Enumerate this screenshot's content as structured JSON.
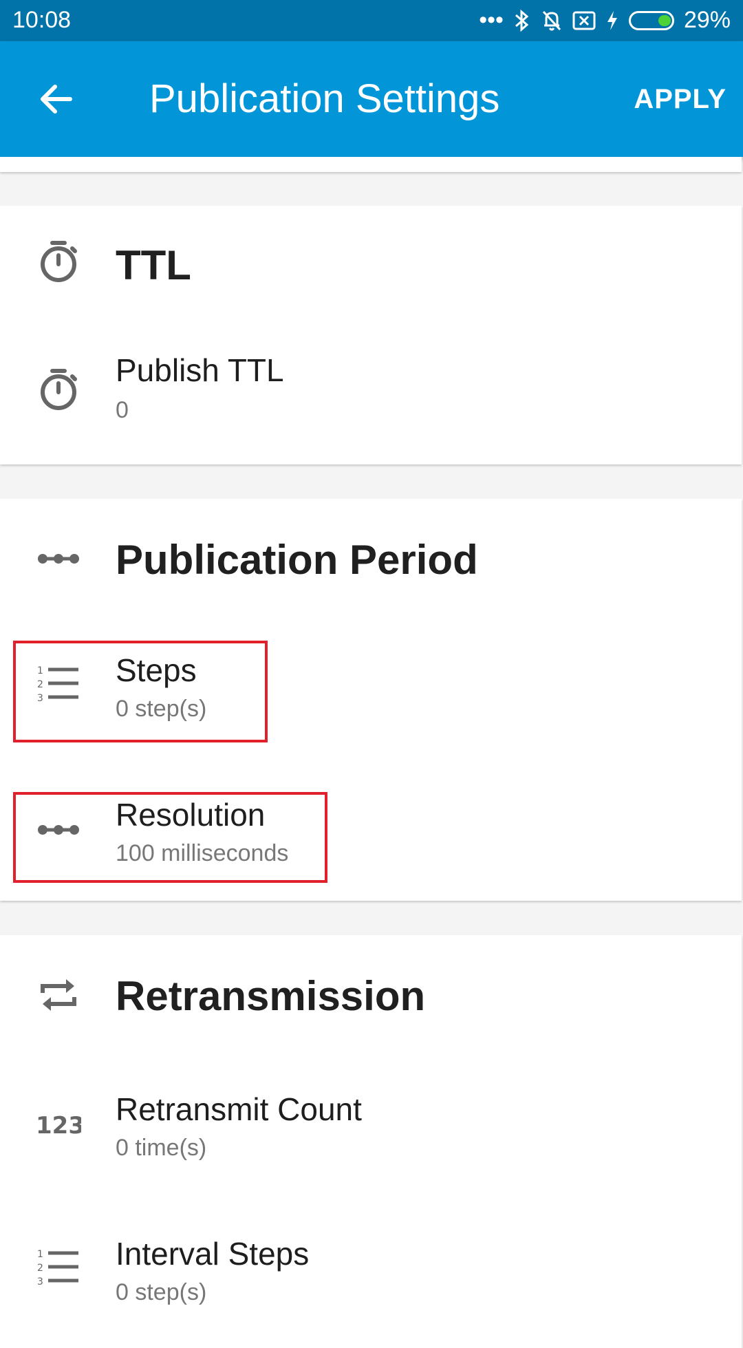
{
  "status_bar": {
    "time": "10:08",
    "battery": "29%",
    "icons": [
      "more-dots-icon",
      "bluetooth-icon",
      "notifications-off-icon",
      "sim-icon",
      "charging-icon",
      "battery-icon"
    ]
  },
  "app_bar": {
    "title": "Publication Settings",
    "apply_label": "APPLY",
    "accent_color": "#0296d8"
  },
  "sections": {
    "ttl": {
      "title": "TTL",
      "publish_ttl": {
        "label": "Publish TTL",
        "value": "0"
      }
    },
    "publication_period": {
      "title": "Publication Period",
      "steps": {
        "label": "Steps",
        "value": "0 step(s)"
      },
      "resolution": {
        "label": "Resolution",
        "value": "100 milliseconds"
      }
    },
    "retransmission": {
      "title": "Retransmission",
      "retransmit_count": {
        "label": "Retransmit Count",
        "value": "0 time(s)"
      },
      "interval_steps": {
        "label": "Interval Steps",
        "value": "0 step(s)"
      }
    }
  }
}
